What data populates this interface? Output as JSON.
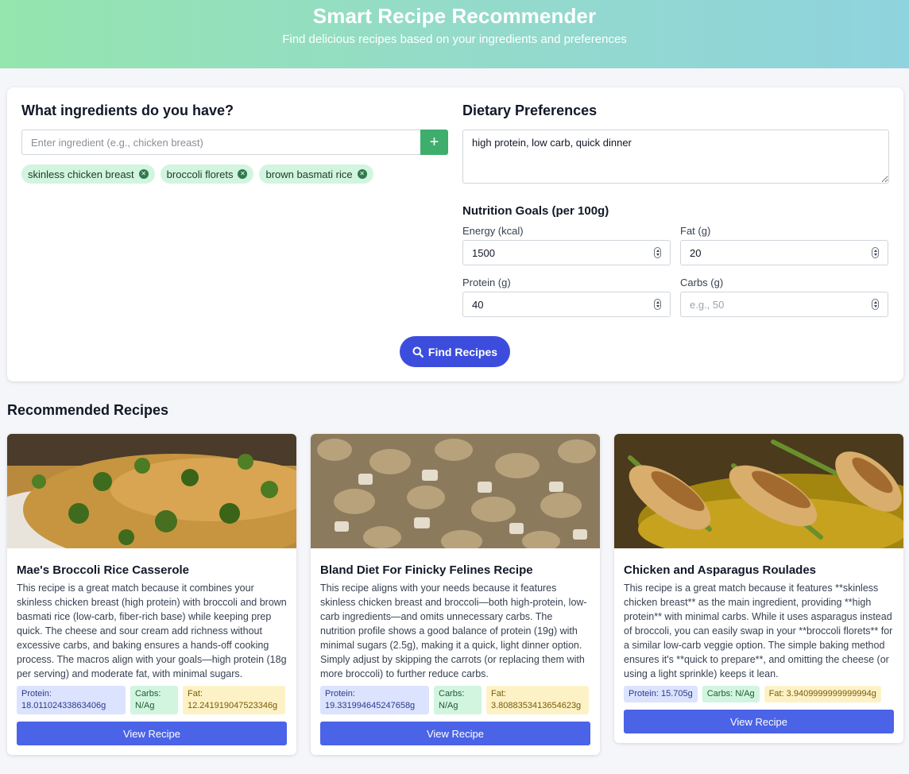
{
  "header": {
    "title": "Smart Recipe Recommender",
    "subtitle": "Find delicious recipes based on your ingredients and preferences"
  },
  "ingredients": {
    "heading": "What ingredients do you have?",
    "placeholder": "Enter ingredient (e.g., chicken breast)",
    "add_label": "+",
    "tags": [
      "skinless chicken breast",
      "broccoli florets",
      "brown basmati rice"
    ]
  },
  "dietary": {
    "heading": "Dietary Preferences",
    "value": "high protein, low carb, quick dinner"
  },
  "nutrition": {
    "heading": "Nutrition Goals (per 100g)",
    "energy": {
      "label": "Energy (kcal)",
      "value": "1500"
    },
    "fat": {
      "label": "Fat (g)",
      "value": "20"
    },
    "protein": {
      "label": "Protein (g)",
      "value": "40"
    },
    "carbs": {
      "label": "Carbs (g)",
      "value": "",
      "placeholder": "e.g., 50"
    }
  },
  "find_button": "Find Recipes",
  "results": {
    "heading": "Recommended Recipes",
    "cards": [
      {
        "title": "Mae's Broccoli Rice Casserole",
        "description": "This recipe is a great match because it combines your skinless chicken breast (high protein) with broccoli and brown basmati rice (low-carb, fiber-rich base) while keeping prep quick. The cheese and sour cream add richness without excessive carbs, and baking ensures a hands-off cooking process. The macros align with your goals—high protein (18g per serving) and moderate fat, with minimal sugars.",
        "protein": "Protein: 18.01102433863406g",
        "carbs": "Carbs: N/Ag",
        "fat": "Fat: 12.241919047523346g",
        "button": "View Recipe"
      },
      {
        "title": "Bland Diet For Finicky Felines Recipe",
        "description": "This recipe aligns with your needs because it features skinless chicken breast and broccoli—both high-protein, low-carb ingredients—and omits unnecessary carbs. The nutrition profile shows a good balance of protein (19g) with minimal sugars (2.5g), making it a quick, light dinner option. Simply adjust by skipping the carrots (or replacing them with more broccoli) to further reduce carbs.",
        "protein": "Protein: 19.331994645247658g",
        "carbs": "Carbs: N/Ag",
        "fat": "Fat: 3.8088353413654623g",
        "button": "View Recipe"
      },
      {
        "title": "Chicken and Asparagus Roulades",
        "description": "This recipe is a great match because it features **skinless chicken breast** as the main ingredient, providing **high protein** with minimal carbs. While it uses asparagus instead of broccoli, you can easily swap in your **broccoli florets** for a similar low-carb veggie option. The simple baking method ensures it's **quick to prepare**, and omitting the cheese (or using a light sprinkle) keeps it lean.",
        "protein": "Protein: 15.705g",
        "carbs": "Carbs: N/Ag",
        "fat": "Fat: 3.9409999999999994g",
        "button": "View Recipe"
      }
    ]
  },
  "colors": {
    "accent": "#3c4ddd",
    "view_button": "#4a63e7",
    "add_button": "#3fae6c",
    "tag_bg": "#d1f5df"
  },
  "icons": {
    "search": "search-icon",
    "remove": "close-icon",
    "add": "plus-icon"
  }
}
